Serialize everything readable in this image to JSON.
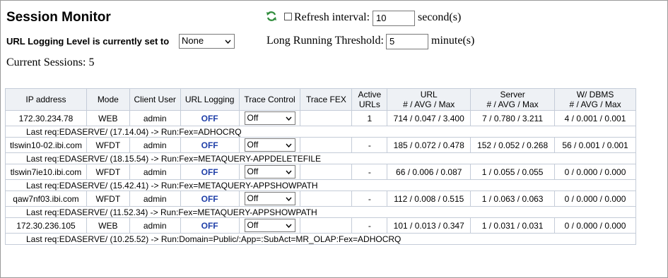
{
  "header": {
    "title": "Session Monitor",
    "refresh_label": "Refresh interval:",
    "refresh_interval": "10",
    "refresh_unit": "second(s)",
    "refresh_checked": false,
    "url_logging_label": "URL Logging Level is currently set to",
    "url_logging_value": "None",
    "threshold_label": "Long Running Threshold:",
    "threshold_value": "5",
    "threshold_unit": "minute(s)",
    "current_sessions": "Current Sessions: 5"
  },
  "table": {
    "columns": {
      "ip": "IP address",
      "mode": "Mode",
      "user": "Client User",
      "urllog": "URL Logging",
      "trace": "Trace Control",
      "tracefex": "Trace FEX",
      "active_1": "Active",
      "active_2": "URLs",
      "url_1": "URL",
      "url_2": "# / AVG / Max",
      "server_1": "Server",
      "server_2": "# / AVG / Max",
      "dbms_1": "W/ DBMS",
      "dbms_2": "# / AVG / Max"
    },
    "rows": [
      {
        "ip": "172.30.234.78",
        "mode": "WEB",
        "user": "admin",
        "urllog": "OFF",
        "trace": "Off",
        "tracefex": "",
        "active": "1",
        "url": "714 / 0.047 / 3.400",
        "server": "7 / 0.780 / 3.211",
        "dbms": "4 / 0.001 / 0.001",
        "lastreq": "Last req:EDASERVE/ (17.14.04) -> Run:Fex=ADHOCRQ"
      },
      {
        "ip": "tlswin10-02.ibi.com",
        "mode": "WFDT",
        "user": "admin",
        "urllog": "OFF",
        "trace": "Off",
        "tracefex": "",
        "active": "-",
        "url": "185 / 0.072 / 0.478",
        "server": "152 / 0.052 / 0.268",
        "dbms": "56 / 0.001 / 0.001",
        "lastreq": "Last req:EDASERVE/ (18.15.54) -> Run:Fex=METAQUERY-APPDELETEFILE"
      },
      {
        "ip": "tlswin7ie10.ibi.com",
        "mode": "WFDT",
        "user": "admin",
        "urllog": "OFF",
        "trace": "Off",
        "tracefex": "",
        "active": "-",
        "url": "66 / 0.006 / 0.087",
        "server": "1 / 0.055 / 0.055",
        "dbms": "0 / 0.000 / 0.000",
        "lastreq": "Last req:EDASERVE/ (15.42.41) -> Run:Fex=METAQUERY-APPSHOWPATH"
      },
      {
        "ip": "qaw7nf03.ibi.com",
        "mode": "WFDT",
        "user": "admin",
        "urllog": "OFF",
        "trace": "Off",
        "tracefex": "",
        "active": "-",
        "url": "112 / 0.008 / 0.515",
        "server": "1 / 0.063 / 0.063",
        "dbms": "0 / 0.000 / 0.000",
        "lastreq": "Last req:EDASERVE/ (11.52.34) -> Run:Fex=METAQUERY-APPSHOWPATH"
      },
      {
        "ip": "172.30.236.105",
        "mode": "WEB",
        "user": "admin",
        "urllog": "OFF",
        "trace": "Off",
        "tracefex": "",
        "active": "-",
        "url": "101 / 0.013 / 0.347",
        "server": "1 / 0.031 / 0.031",
        "dbms": "0 / 0.000 / 0.000",
        "lastreq": "Last req:EDASERVE/ (10.25.52) -> Run:Domain=Public/:App=:SubAct=MR_OLAP:Fex=ADHOCRQ"
      }
    ]
  },
  "colors": {
    "off_text": "#1f3fa8",
    "header_bg": "#eef1f5",
    "grid_border": "#c4ccd8",
    "refresh_icon": "#2e8b3a"
  },
  "icons": {
    "refresh": "refresh-icon",
    "dropdown": "chevron-down-icon"
  }
}
